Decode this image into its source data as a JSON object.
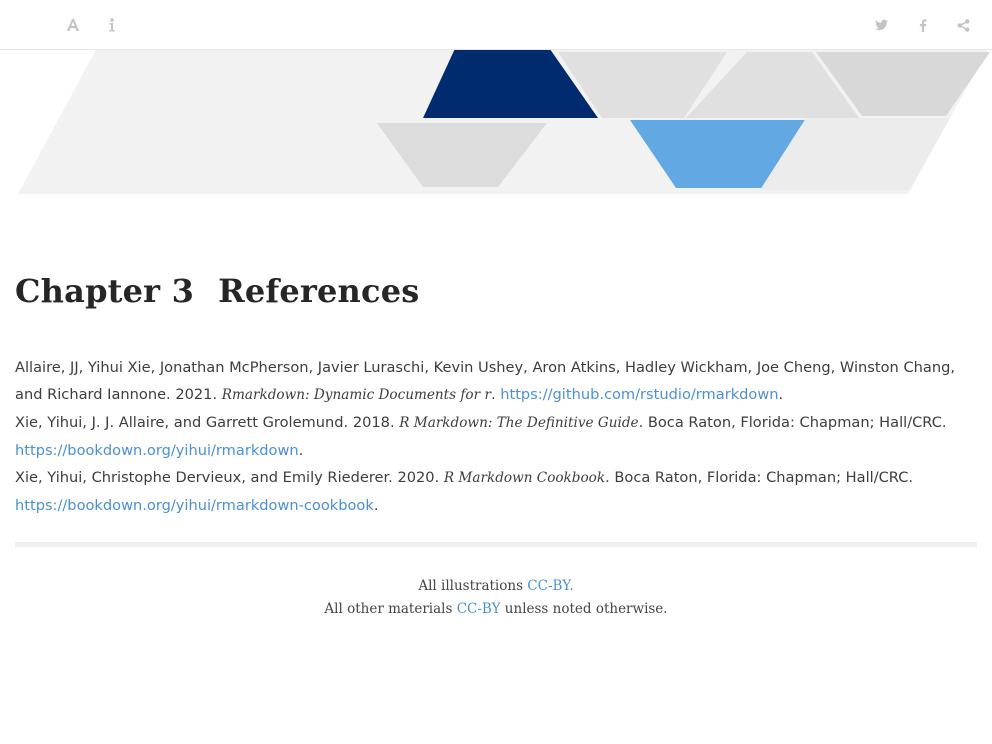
{
  "toolbar": {
    "left_icons": [
      "font-settings-icon",
      "info-icon"
    ],
    "right_icons": [
      "twitter-icon",
      "facebook-icon",
      "share-icon"
    ]
  },
  "banner": {
    "colors": {
      "dark_blue": "#002b6e",
      "light_blue": "#62a8e3",
      "gray": "#e0e0e0",
      "light_gray": "#f1f1f1"
    }
  },
  "chapter": {
    "number": "Chapter 3",
    "title": "References"
  },
  "references": [
    {
      "authors": "Allaire, JJ, Yihui Xie, Jonathan McPherson, Javier Luraschi, Kevin Ushey, Aron Atkins, Hadley Wickham, Joe Cheng, Winston Chang, and Richard Iannone. 2021. ",
      "title": "Rmarkdown: Dynamic Documents for r",
      "after_title": ". ",
      "url": "https://github.com/rstudio/rmarkdown",
      "end": "."
    },
    {
      "authors": "Xie, Yihui, J. J. Allaire, and Garrett Grolemund. 2018. ",
      "title": "R Markdown: The Definitive Guide",
      "after_title": ". Boca Raton, Florida: Chapman; Hall/CRC. ",
      "url": "https://bookdown.org/yihui/rmarkdown",
      "end": "."
    },
    {
      "authors": "Xie, Yihui, Christophe Dervieux, and Emily Riederer. 2020. ",
      "title": "R Markdown Cookbook",
      "after_title": ". Boca Raton, Florida: Chapman; Hall/CRC. ",
      "url": "https://bookdown.org/yihui/rmarkdown-cookbook",
      "end": "."
    }
  ],
  "footer": {
    "line1_prefix": "All illustrations ",
    "line1_link": "CC-BY.",
    "line2_prefix": "All other materials ",
    "line2_link": "CC-BY",
    "line2_suffix": " unless noted otherwise."
  }
}
